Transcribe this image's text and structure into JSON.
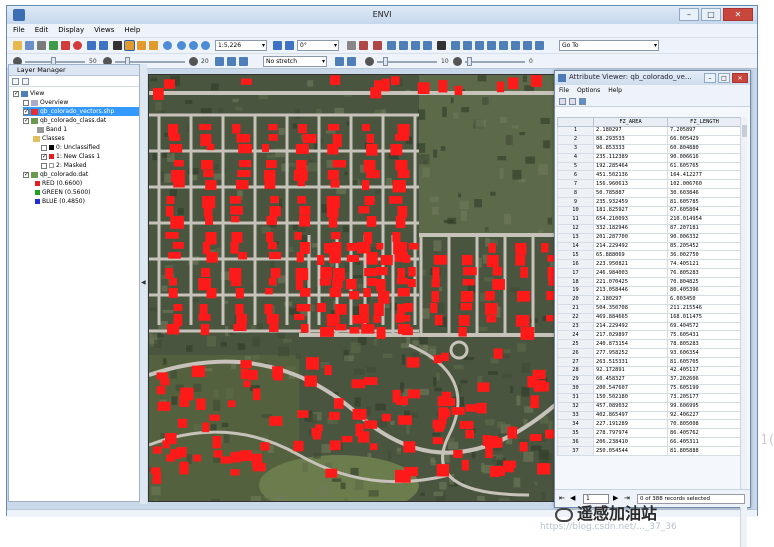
{
  "window": {
    "title": "ENVI"
  },
  "menu": [
    "File",
    "Edit",
    "Display",
    "Views",
    "Help"
  ],
  "toolbar": {
    "zoom_value": "1:5,226",
    "rotate_value": "0°",
    "goto_value": "Go To",
    "stretch_value": "No stretch",
    "brightness_value": "50",
    "contrast_value": "20",
    "sharpen_value": "10",
    "transparency_value": "0"
  },
  "layer_manager": {
    "title": "Layer Manager",
    "items": [
      {
        "label": "View",
        "checked": true
      },
      {
        "label": "Overview",
        "checked": false
      },
      {
        "label": "qb_colorado_vectors.shp",
        "checked": true,
        "selected": true
      },
      {
        "label": "qb_colorado_class.dat",
        "checked": true
      },
      {
        "label": "Band 1",
        "checked": false
      },
      {
        "label": "Classes",
        "checked": false
      },
      {
        "label": "0: Unclassified",
        "checked": false
      },
      {
        "label": "1: New Class 1",
        "checked": true
      },
      {
        "label": "2: Masked",
        "checked": false
      },
      {
        "label": "qb_colorado.dat",
        "checked": true
      },
      {
        "label": "RED (0.6600)",
        "color": "#e02020"
      },
      {
        "label": "GREEN (0.5600)",
        "color": "#20a020"
      },
      {
        "label": "BLUE (0.4850)",
        "color": "#2030d0"
      }
    ]
  },
  "attribute_viewer": {
    "title": "Attribute Viewer: qb_colorado_ve...",
    "menu": [
      "File",
      "Options",
      "Help"
    ],
    "columns": [
      "FZ_AREA",
      "FZ_LENGTH"
    ],
    "rows": [
      [
        "1",
        "2.180297",
        "7.205897"
      ],
      [
        "2",
        "88.293533",
        "66.005429"
      ],
      [
        "3",
        "96.853333",
        "60.804880"
      ],
      [
        "4",
        "235.112389",
        "90.006616"
      ],
      [
        "5",
        "192.285464",
        "61.605765"
      ],
      [
        "6",
        "451.502136",
        "164.412277"
      ],
      [
        "7",
        "156.960613",
        "102.006760"
      ],
      [
        "8",
        "50.785887",
        "30.603846"
      ],
      [
        "9",
        "235.932459",
        "81.605785"
      ],
      [
        "10",
        "181.825927",
        "67.605804"
      ],
      [
        "11",
        "654.210093",
        "210.014954"
      ],
      [
        "12",
        "332.182946",
        "87.207181"
      ],
      [
        "13",
        "201.287700",
        "90.006332"
      ],
      [
        "14",
        "214.229492",
        "85.205452"
      ],
      [
        "15",
        "65.888069",
        "36.002750"
      ],
      [
        "16",
        "223.950821",
        "74.405121"
      ],
      [
        "17",
        "246.984003",
        "76.805283"
      ],
      [
        "18",
        "221.070425",
        "70.804825"
      ],
      [
        "19",
        "213.058446",
        "80.405396"
      ],
      [
        "20",
        "2.180297",
        "6.003450"
      ],
      [
        "21",
        "504.350708",
        "211.215546"
      ],
      [
        "22",
        "469.884665",
        "168.011475"
      ],
      [
        "23",
        "214.229492",
        "69.404572"
      ],
      [
        "24",
        "217.029897",
        "75.605431"
      ],
      [
        "25",
        "240.873154",
        "78.805283"
      ],
      [
        "26",
        "277.958252",
        "93.606354"
      ],
      [
        "27",
        "263.515331",
        "81.605705"
      ],
      [
        "28",
        "92.172891",
        "42.405117"
      ],
      [
        "29",
        "60.458327",
        "37.202606"
      ],
      [
        "30",
        "200.547607",
        "75.605199"
      ],
      [
        "31",
        "150.502180",
        "73.205177"
      ],
      [
        "32",
        "457.089032",
        "99.606995"
      ],
      [
        "33",
        "402.865497",
        "92.406227"
      ],
      [
        "34",
        "227.191289",
        "70.805008"
      ],
      [
        "35",
        "278.797974",
        "86.405762"
      ],
      [
        "36",
        "206.238410",
        "66.405311"
      ],
      [
        "37",
        "250.054544",
        "81.805888"
      ]
    ],
    "page_value": "1",
    "status": "0 of 388 records selected"
  },
  "watermark": {
    "brand": "遥感加油站",
    "url": "https://blog.csdn.net/..._37_36",
    "side_mark": "1("
  }
}
